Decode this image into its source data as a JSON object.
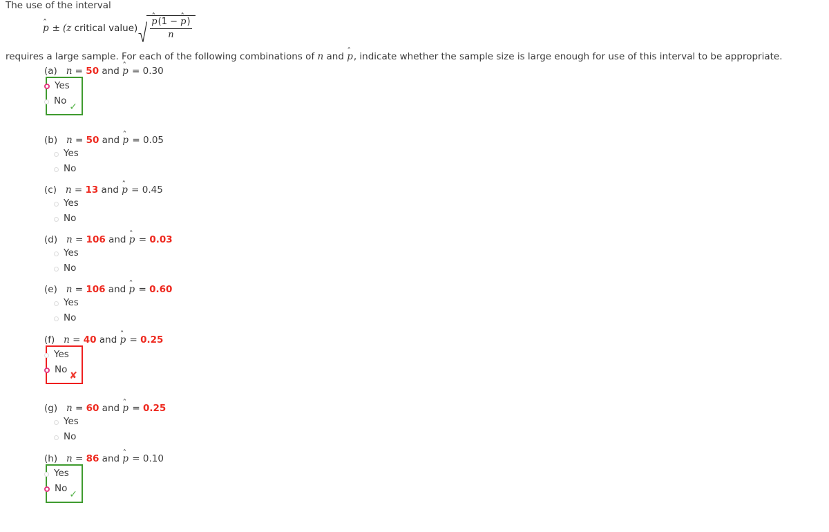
{
  "document": {
    "intro_line": "The use of the interval",
    "formula": {
      "p_hat": "p",
      "plus_minus": "±",
      "z_critical_text": "(z critical value)",
      "numerator_left": "p",
      "numerator_mid": "(1 − ",
      "numerator_right": "p",
      "numerator_close": ")",
      "denominator": "n",
      "radical_symbol": "√"
    },
    "instruction_line": "requires a large sample. For each of the following combinations of n and p̂, indicate whether the sample size is large enough for use of this interval to be appropriate."
  },
  "colors": {
    "value_red": "#ee2a20",
    "correct_green": "#3f9b2f",
    "incorrect_red": "#ef1f1f",
    "radio_selected": "#e33a82",
    "text": "#3b3b3b"
  },
  "choice_labels": {
    "yes": "Yes",
    "no": "No"
  },
  "marks": {
    "correct": "✓",
    "incorrect": "✘"
  },
  "questions": [
    {
      "tag": "(a)",
      "n_label": "n = ",
      "n_value": "50",
      "n_red": true,
      "and_text": " and ",
      "p_label": " = ",
      "p_value": "0.30",
      "p_red": false,
      "selected": "Yes",
      "boxed": true,
      "result": "correct"
    },
    {
      "tag": "(b)",
      "n_label": "n = ",
      "n_value": "50",
      "n_red": true,
      "and_text": " and ",
      "p_label": " = ",
      "p_value": "0.05",
      "p_red": false,
      "selected": null,
      "boxed": false,
      "result": null
    },
    {
      "tag": "(c)",
      "n_label": "n = ",
      "n_value": "13",
      "n_red": true,
      "and_text": " and ",
      "p_label": " = ",
      "p_value": "0.45",
      "p_red": false,
      "selected": null,
      "boxed": false,
      "result": null
    },
    {
      "tag": "(d)",
      "n_label": "n = ",
      "n_value": "106",
      "n_red": true,
      "and_text": " and ",
      "p_label": " = ",
      "p_value": "0.03",
      "p_red": true,
      "selected": null,
      "boxed": false,
      "result": null
    },
    {
      "tag": "(e)",
      "n_label": "n = ",
      "n_value": "106",
      "n_red": true,
      "and_text": " and ",
      "p_label": " = ",
      "p_value": "0.60",
      "p_red": true,
      "selected": null,
      "boxed": false,
      "result": null
    },
    {
      "tag": "(f)",
      "n_label": "n = ",
      "n_value": "40",
      "n_red": true,
      "and_text": " and ",
      "p_label": " = ",
      "p_value": "0.25",
      "p_red": true,
      "selected": "No",
      "boxed": true,
      "result": "incorrect"
    },
    {
      "tag": "(g)",
      "n_label": "n = ",
      "n_value": "60",
      "n_red": true,
      "and_text": " and ",
      "p_label": " = ",
      "p_value": "0.25",
      "p_red": true,
      "selected": null,
      "boxed": false,
      "result": null
    },
    {
      "tag": "(h)",
      "n_label": "n = ",
      "n_value": "86",
      "n_red": true,
      "and_text": " and ",
      "p_label": " = ",
      "p_value": "0.10",
      "p_red": false,
      "selected": "No",
      "boxed": true,
      "result": "correct"
    }
  ]
}
